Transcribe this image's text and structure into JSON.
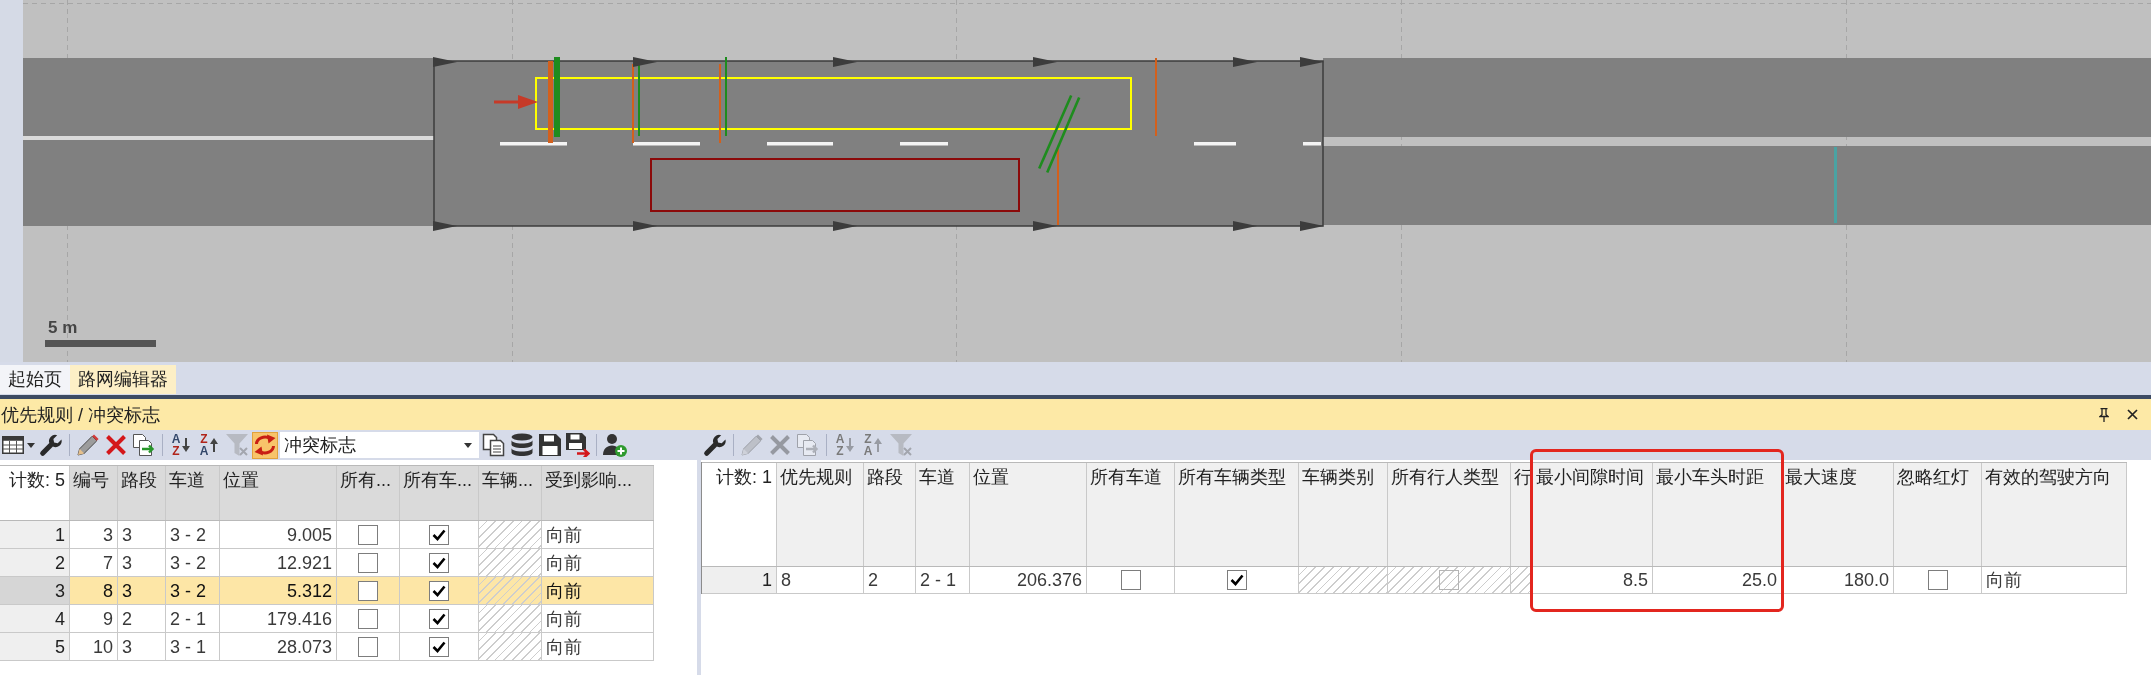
{
  "network_view": {
    "scale_label": "5 m"
  },
  "tabs": [
    {
      "label": "起始页",
      "selected": false
    },
    {
      "label": "路网编辑器",
      "selected": true
    }
  ],
  "panel": {
    "title": "优先规则 / 冲突标志"
  },
  "left_toolbar": {
    "buttons": [
      {
        "disabled": false,
        "on": false
      },
      {
        "disabled": false,
        "on": false
      },
      {
        "disabled": false,
        "on": false
      },
      {
        "disabled": false,
        "on": false
      },
      {
        "disabled": false,
        "on": false
      },
      {
        "letters": [
          "A",
          "Z"
        ],
        "disabled": false,
        "on": false
      },
      {
        "letters": [
          "Z",
          "A"
        ],
        "disabled": false,
        "on": false
      },
      {
        "disabled": true,
        "on": false
      },
      {
        "disabled": false,
        "on": true
      }
    ],
    "selector": "冲突标志",
    "more_buttons": [
      {
        "disabled": false
      },
      {
        "disabled": false
      },
      {
        "disabled": false
      },
      {
        "disabled": false
      },
      {
        "disabled": false
      }
    ]
  },
  "left_table": {
    "count_label": "计数: 5",
    "columns": [
      {
        "label": "编号",
        "kind": "number"
      },
      {
        "label": "路段",
        "kind": "text"
      },
      {
        "label": "车道",
        "kind": "text"
      },
      {
        "label": "位置",
        "kind": "number"
      },
      {
        "label": "所有...",
        "kind": "check"
      },
      {
        "label": "所有车...",
        "kind": "check"
      },
      {
        "label": "车辆...",
        "kind": "text"
      },
      {
        "label": "受到影响...",
        "kind": "text"
      }
    ],
    "rows": [
      {
        "number": "1",
        "selected": false,
        "cells": [
          {
            "text": "3",
            "disabled": false
          },
          {
            "text": "3",
            "disabled": false
          },
          {
            "text": "3 - 2",
            "disabled": false
          },
          {
            "text": "9.005",
            "disabled": false
          },
          {
            "checked": false,
            "disabled": false
          },
          {
            "checked": true,
            "disabled": false
          },
          {
            "disabled": true
          },
          {
            "text": "向前",
            "disabled": false
          }
        ]
      },
      {
        "number": "2",
        "selected": false,
        "cells": [
          {
            "text": "7",
            "disabled": false
          },
          {
            "text": "3",
            "disabled": false
          },
          {
            "text": "3 - 2",
            "disabled": false
          },
          {
            "text": "12.921",
            "disabled": false
          },
          {
            "checked": false,
            "disabled": false
          },
          {
            "checked": true,
            "disabled": false
          },
          {
            "disabled": true
          },
          {
            "text": "向前",
            "disabled": false
          }
        ]
      },
      {
        "number": "3",
        "selected": true,
        "cells": [
          {
            "text": "8",
            "disabled": false
          },
          {
            "text": "3",
            "disabled": false
          },
          {
            "text": "3 - 2",
            "disabled": false
          },
          {
            "text": "5.312",
            "disabled": false
          },
          {
            "checked": false,
            "disabled": false
          },
          {
            "checked": true,
            "disabled": false
          },
          {
            "disabled": true
          },
          {
            "text": "向前",
            "disabled": false
          }
        ]
      },
      {
        "number": "4",
        "selected": false,
        "cells": [
          {
            "text": "9",
            "disabled": false
          },
          {
            "text": "2",
            "disabled": false
          },
          {
            "text": "2 - 1",
            "disabled": false
          },
          {
            "text": "179.416",
            "disabled": false
          },
          {
            "checked": false,
            "disabled": false
          },
          {
            "checked": true,
            "disabled": false
          },
          {
            "disabled": true
          },
          {
            "text": "向前",
            "disabled": false
          }
        ]
      },
      {
        "number": "5",
        "selected": false,
        "cells": [
          {
            "text": "10",
            "disabled": false
          },
          {
            "text": "3",
            "disabled": false
          },
          {
            "text": "3 - 1",
            "disabled": false
          },
          {
            "text": "28.073",
            "disabled": false
          },
          {
            "checked": false,
            "disabled": false
          },
          {
            "checked": true,
            "disabled": false
          },
          {
            "disabled": true
          },
          {
            "text": "向前",
            "disabled": false
          }
        ]
      }
    ]
  },
  "right_toolbar": {
    "buttons": [
      {
        "disabled": false
      },
      {
        "disabled": true
      },
      {
        "disabled": true
      },
      {
        "disabled": true
      },
      {
        "letters": [
          "A",
          "Z"
        ],
        "disabled": true
      },
      {
        "letters": [
          "Z",
          "A"
        ],
        "disabled": true
      },
      {
        "disabled": true
      }
    ]
  },
  "right_table": {
    "count_label": "计数: 1",
    "columns": [
      {
        "label": "优先规则",
        "kind": "text"
      },
      {
        "label": "路段",
        "kind": "text"
      },
      {
        "label": "车道",
        "kind": "text"
      },
      {
        "label": "位置",
        "kind": "number"
      },
      {
        "label": "所有车道",
        "kind": "check"
      },
      {
        "label": "所有车辆类型",
        "kind": "check"
      },
      {
        "label": "车辆类别",
        "kind": "text"
      },
      {
        "label": "所有行人类型",
        "kind": "check"
      },
      {
        "label": "行",
        "kind": "text"
      },
      {
        "label": "最小间隙时间",
        "kind": "number"
      },
      {
        "label": "最小车头时距",
        "kind": "number"
      },
      {
        "label": "最大速度",
        "kind": "number"
      },
      {
        "label": "忽略红灯",
        "kind": "check"
      },
      {
        "label": "有效的驾驶方向",
        "kind": "text"
      }
    ],
    "rows": [
      {
        "number": "1",
        "selected": false,
        "cells": [
          {
            "text": "8",
            "disabled": false
          },
          {
            "text": "2",
            "disabled": false
          },
          {
            "text": "2 - 1",
            "disabled": false
          },
          {
            "text": "206.376",
            "disabled": false
          },
          {
            "checked": false,
            "disabled": false
          },
          {
            "checked": true,
            "disabled": false
          },
          {
            "disabled": true
          },
          {
            "checked": false,
            "disabled": true
          },
          {
            "disabled": true
          },
          {
            "text": "8.5",
            "disabled": false
          },
          {
            "text": "25.0",
            "disabled": false
          },
          {
            "text": "180.0",
            "disabled": false
          },
          {
            "checked": false,
            "disabled": false
          },
          {
            "text": "向前",
            "disabled": false
          }
        ]
      }
    ]
  }
}
